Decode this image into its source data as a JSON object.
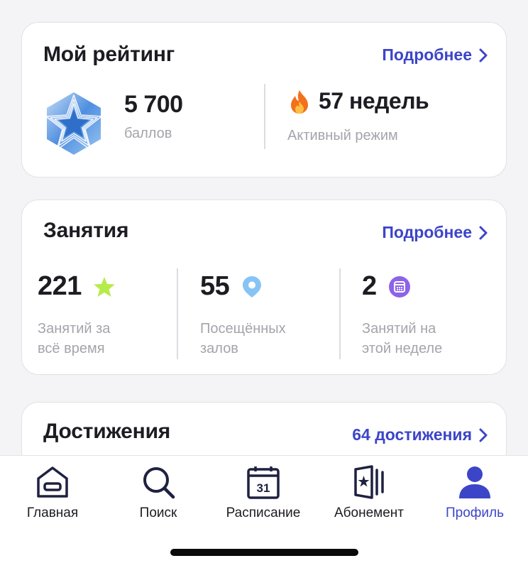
{
  "rating": {
    "title": "Мой рейтинг",
    "more_label": "Подробнее",
    "points_value": "5 700",
    "points_label": "баллов",
    "streak_value": "57 недель",
    "streak_label": "Активный режим"
  },
  "classes": {
    "title": "Занятия",
    "more_label": "Подробнее",
    "stats": [
      {
        "value": "221",
        "label_line1": "Занятий за",
        "label_line2": "всё время"
      },
      {
        "value": "55",
        "label_line1": "Посещённых",
        "label_line2": "залов"
      },
      {
        "value": "2",
        "label_line1": "Занятий на",
        "label_line2": "этой неделе"
      }
    ]
  },
  "achievements": {
    "title": "Достижения",
    "count_label": "64 достижения"
  },
  "tabbar": {
    "items": [
      {
        "label": "Главная",
        "icon": "home-icon"
      },
      {
        "label": "Поиск",
        "icon": "search-icon"
      },
      {
        "label": "Расписание",
        "icon": "calendar-icon",
        "icon_text": "31"
      },
      {
        "label": "Абонемент",
        "icon": "membership-card-icon"
      },
      {
        "label": "Профиль",
        "icon": "profile-icon",
        "active": true
      }
    ]
  },
  "colors": {
    "accent": "#3c45c8",
    "star_green": "#b6ec4a",
    "pin_blue": "#86c4f5",
    "calendar_purple": "#8d63e8",
    "fire_orange": "#f2711c"
  }
}
